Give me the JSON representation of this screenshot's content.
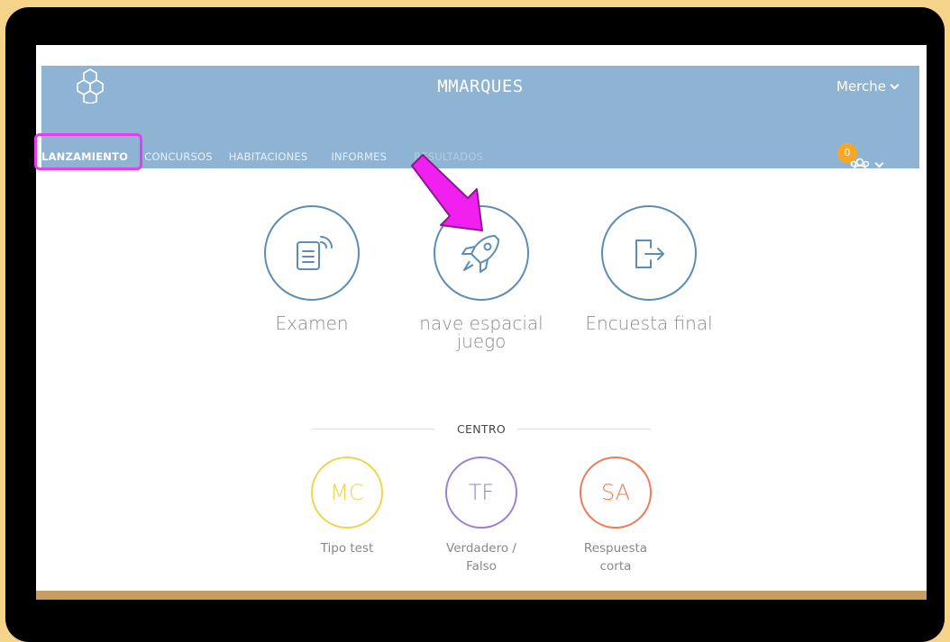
{
  "header": {
    "app_title": "MMARQUES",
    "user_name": "Merche",
    "notification_count": "0"
  },
  "nav": {
    "items": [
      {
        "label": "LANZAMIENTO"
      },
      {
        "label": "CONCURSOS"
      },
      {
        "label": "HABITACIONES"
      },
      {
        "label": "INFORMES"
      },
      {
        "label": "RESULTADOS"
      }
    ]
  },
  "launch": {
    "items": [
      {
        "label": "Examen",
        "icon": "quiz-remote-icon"
      },
      {
        "label_line1": "nave espacial",
        "label_line2": "juego",
        "icon": "rocket-icon"
      },
      {
        "label": "Encuesta final",
        "icon": "exit-icon"
      }
    ]
  },
  "centro": {
    "title": "CENTRO",
    "items": [
      {
        "abbr": "MC",
        "label": "Tipo test",
        "color": "#efd44b"
      },
      {
        "abbr": "TF",
        "label_line1": "Verdadero /",
        "label_line2": "Falso",
        "color": "#9b7fd4"
      },
      {
        "abbr": "SA",
        "label_line1": "Respuesta",
        "label_line2": "corta",
        "color": "#ee7a55"
      }
    ]
  },
  "colors": {
    "header_bg": "#8fb3d3",
    "accent_blue": "#5d8cb5",
    "highlight": "#e43ef0",
    "badge": "#f7a823"
  }
}
